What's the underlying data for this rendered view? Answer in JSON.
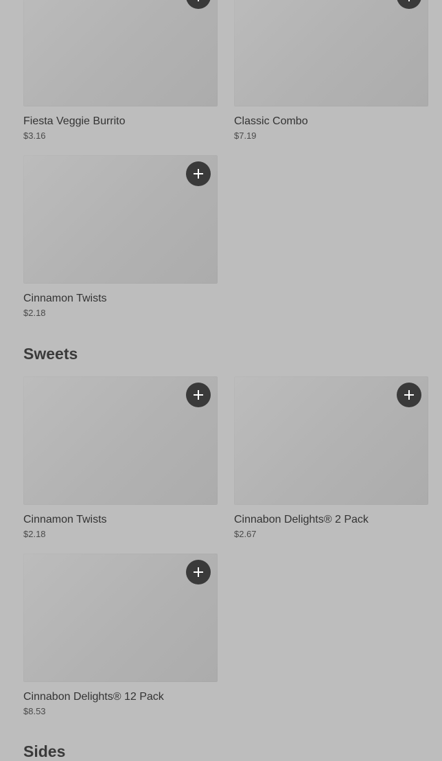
{
  "icons": {
    "add": "plus-icon"
  },
  "colors": {
    "background": "#bdbdbd",
    "thumbnail": "#b2b2b2",
    "add_button": "#3a3a3a",
    "add_icon": "#ffffff",
    "text": "#333333"
  },
  "top_section": {
    "items": [
      {
        "name": "Fiesta Veggie Burrito",
        "price": "$3.16"
      },
      {
        "name": "Classic Combo",
        "price": "$7.19"
      },
      {
        "name": "Cinnamon Twists",
        "price": "$2.18"
      }
    ]
  },
  "sweets": {
    "title": "Sweets",
    "items": [
      {
        "name": "Cinnamon Twists",
        "price": "$2.18"
      },
      {
        "name": "Cinnabon Delights® 2 Pack",
        "price": "$2.67"
      },
      {
        "name": "Cinnabon Delights® 12 Pack",
        "price": "$8.53"
      }
    ]
  },
  "sides": {
    "title": "Sides"
  }
}
